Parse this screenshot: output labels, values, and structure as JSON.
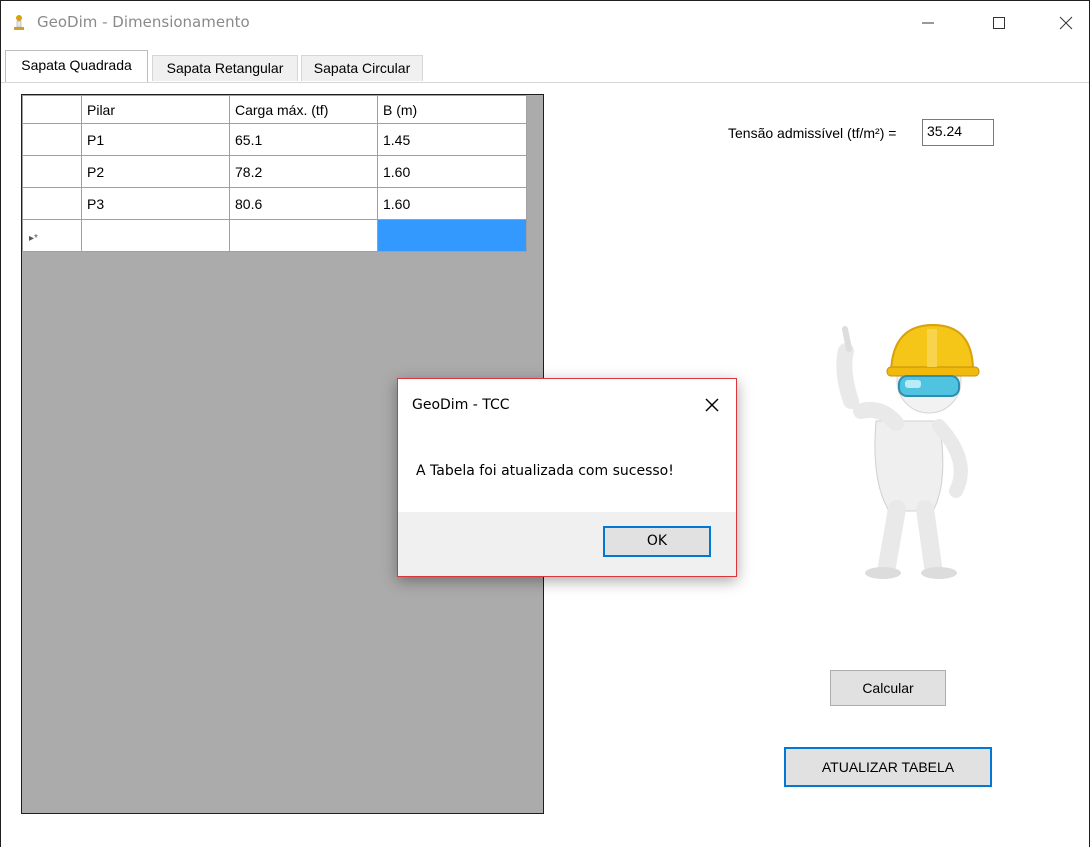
{
  "window": {
    "title": "GeoDim - Dimensionamento",
    "minimize_icon": "minimize-icon",
    "maximize_icon": "maximize-icon",
    "close_icon": "close-icon"
  },
  "tabs": [
    {
      "label": "Sapata Quadrada",
      "active": true
    },
    {
      "label": "Sapata Retangular",
      "active": false
    },
    {
      "label": "Sapata Circular",
      "active": false
    }
  ],
  "grid": {
    "columns": [
      "Pilar",
      "Carga máx. (tf)",
      "B (m)"
    ],
    "rows": [
      [
        "P1",
        "65.1",
        "1.45"
      ],
      [
        "P2",
        "78.2",
        "1.60"
      ],
      [
        "P3",
        "80.6",
        "1.60"
      ]
    ],
    "new_row_marker": "▸*"
  },
  "tensao": {
    "label": "Tensão admissível (tf/m²) =",
    "value": "35.24"
  },
  "buttons": {
    "calcular": "Calcular",
    "atualizar": "ATUALIZAR TABELA"
  },
  "dialog": {
    "title": "GeoDim - TCC",
    "message": "A Tabela foi atualizada com sucesso!",
    "ok_label": "OK"
  },
  "colors": {
    "selection": "#3399ff",
    "grid_background": "#ababab",
    "focus_border": "#0078d7",
    "dialog_border": "#d9363e"
  }
}
